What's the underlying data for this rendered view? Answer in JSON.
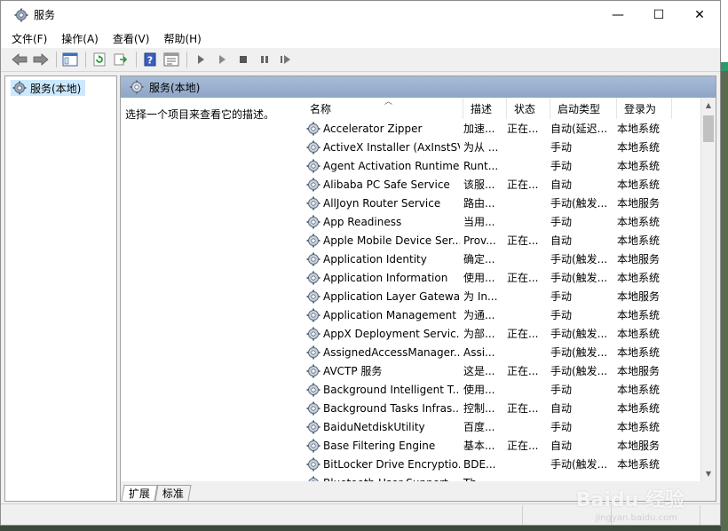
{
  "window": {
    "title": "服务"
  },
  "window_controls": {
    "minimize": "—",
    "maximize": "☐",
    "close": "✕"
  },
  "menu": [
    "文件(F)",
    "操作(A)",
    "查看(V)",
    "帮助(H)"
  ],
  "tree": {
    "root": "服务(本地)"
  },
  "content": {
    "header": "服务(本地)",
    "description": "选择一个项目来查看它的描述。"
  },
  "columns": {
    "name": "名称",
    "desc": "描述",
    "state": "状态",
    "start": "启动类型",
    "login": "登录为"
  },
  "services": [
    {
      "name": "Accelerator  Zipper",
      "desc": "加速...",
      "state": "正在...",
      "start": "自动(延迟...",
      "login": "本地系统"
    },
    {
      "name": "ActiveX Installer (AxInstSV)",
      "desc": "为从 ...",
      "state": "",
      "start": "手动",
      "login": "本地系统"
    },
    {
      "name": "Agent Activation Runtime...",
      "desc": "Runt...",
      "state": "",
      "start": "手动",
      "login": "本地系统"
    },
    {
      "name": "Alibaba PC Safe Service",
      "desc": "该服...",
      "state": "正在...",
      "start": "自动",
      "login": "本地系统"
    },
    {
      "name": "AllJoyn Router Service",
      "desc": "路由...",
      "state": "",
      "start": "手动(触发...",
      "login": "本地服务"
    },
    {
      "name": "App Readiness",
      "desc": "当用...",
      "state": "",
      "start": "手动",
      "login": "本地系统"
    },
    {
      "name": "Apple Mobile Device Ser...",
      "desc": "Prov...",
      "state": "正在...",
      "start": "自动",
      "login": "本地系统"
    },
    {
      "name": "Application Identity",
      "desc": "确定...",
      "state": "",
      "start": "手动(触发...",
      "login": "本地服务"
    },
    {
      "name": "Application Information",
      "desc": "使用...",
      "state": "正在...",
      "start": "手动(触发...",
      "login": "本地系统"
    },
    {
      "name": "Application Layer Gatewa...",
      "desc": "为 In...",
      "state": "",
      "start": "手动",
      "login": "本地服务"
    },
    {
      "name": "Application Management",
      "desc": "为通...",
      "state": "",
      "start": "手动",
      "login": "本地系统"
    },
    {
      "name": "AppX Deployment Servic...",
      "desc": "为部...",
      "state": "正在...",
      "start": "手动(触发...",
      "login": "本地系统"
    },
    {
      "name": "AssignedAccessManager...",
      "desc": "Assi...",
      "state": "",
      "start": "手动(触发...",
      "login": "本地系统"
    },
    {
      "name": "AVCTP 服务",
      "desc": "这是...",
      "state": "正在...",
      "start": "手动(触发...",
      "login": "本地服务"
    },
    {
      "name": "Background Intelligent T...",
      "desc": "使用...",
      "state": "",
      "start": "手动",
      "login": "本地系统"
    },
    {
      "name": "Background Tasks Infras...",
      "desc": "控制...",
      "state": "正在...",
      "start": "自动",
      "login": "本地系统"
    },
    {
      "name": "BaiduNetdiskUtility",
      "desc": "百度...",
      "state": "",
      "start": "手动",
      "login": "本地系统"
    },
    {
      "name": "Base Filtering Engine",
      "desc": "基本...",
      "state": "正在...",
      "start": "自动",
      "login": "本地服务"
    },
    {
      "name": "BitLocker Drive Encryptio...",
      "desc": "BDE...",
      "state": "",
      "start": "手动(触发...",
      "login": "本地系统"
    },
    {
      "name": "Bluetooth User Support...",
      "desc": "Th...",
      "state": "",
      "start": "",
      "login": ""
    }
  ],
  "tabs": [
    "扩展",
    "标准"
  ],
  "watermark": {
    "main": "Baidu 经验",
    "sub": "jingyan.baidu.com"
  }
}
